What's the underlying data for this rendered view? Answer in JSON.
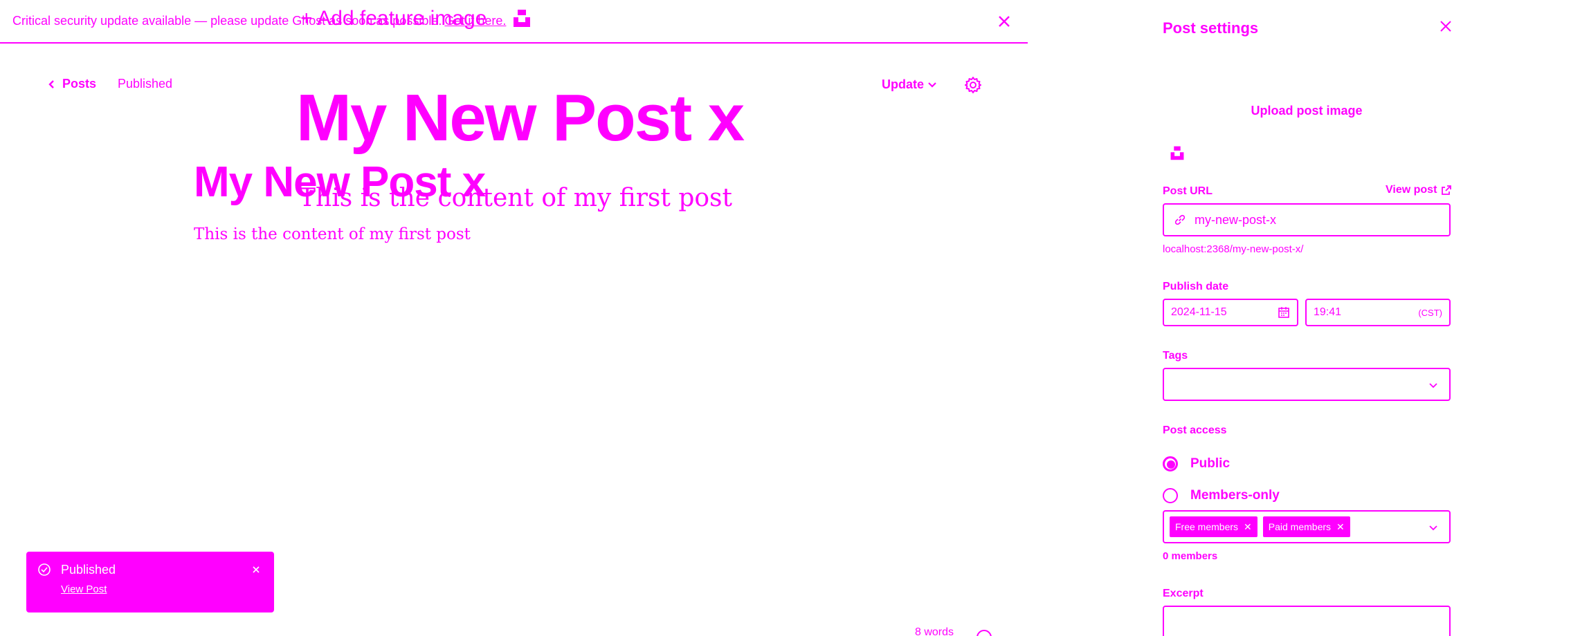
{
  "banner": {
    "text": "Critical security update available — please update Ghost as soon as possible.",
    "link": "Get it here."
  },
  "overlay": {
    "add_feature_image": "+ Add feature image",
    "title_large": "My New Post x",
    "content_large": "This is the content of my first post"
  },
  "editor": {
    "back_label": "Posts",
    "status": "Published",
    "update_label": "Update",
    "title": "My New Post x",
    "content": "This is the content of my first post",
    "word_count": "8 words"
  },
  "toast": {
    "title": "Published",
    "link": "View Post"
  },
  "settings": {
    "title": "Post settings",
    "upload_image": "Upload post image",
    "url_label": "Post URL",
    "view_post": "View post",
    "slug": "my-new-post-x",
    "url_preview": "localhost:2368/my-new-post-x/",
    "publish_date_label": "Publish date",
    "date": "2024-11-15",
    "time": "19:41",
    "timezone": "(CST)",
    "tags_label": "Tags",
    "access_label": "Post access",
    "access_options": [
      "Public",
      "Members-only"
    ],
    "access_selected": "Public",
    "segments": [
      "Free members",
      "Paid members"
    ],
    "members_count": "0",
    "members_suffix": "members",
    "excerpt_label": "Excerpt"
  },
  "colors": {
    "accent": "#ff00ff",
    "background": "#ffffff"
  }
}
